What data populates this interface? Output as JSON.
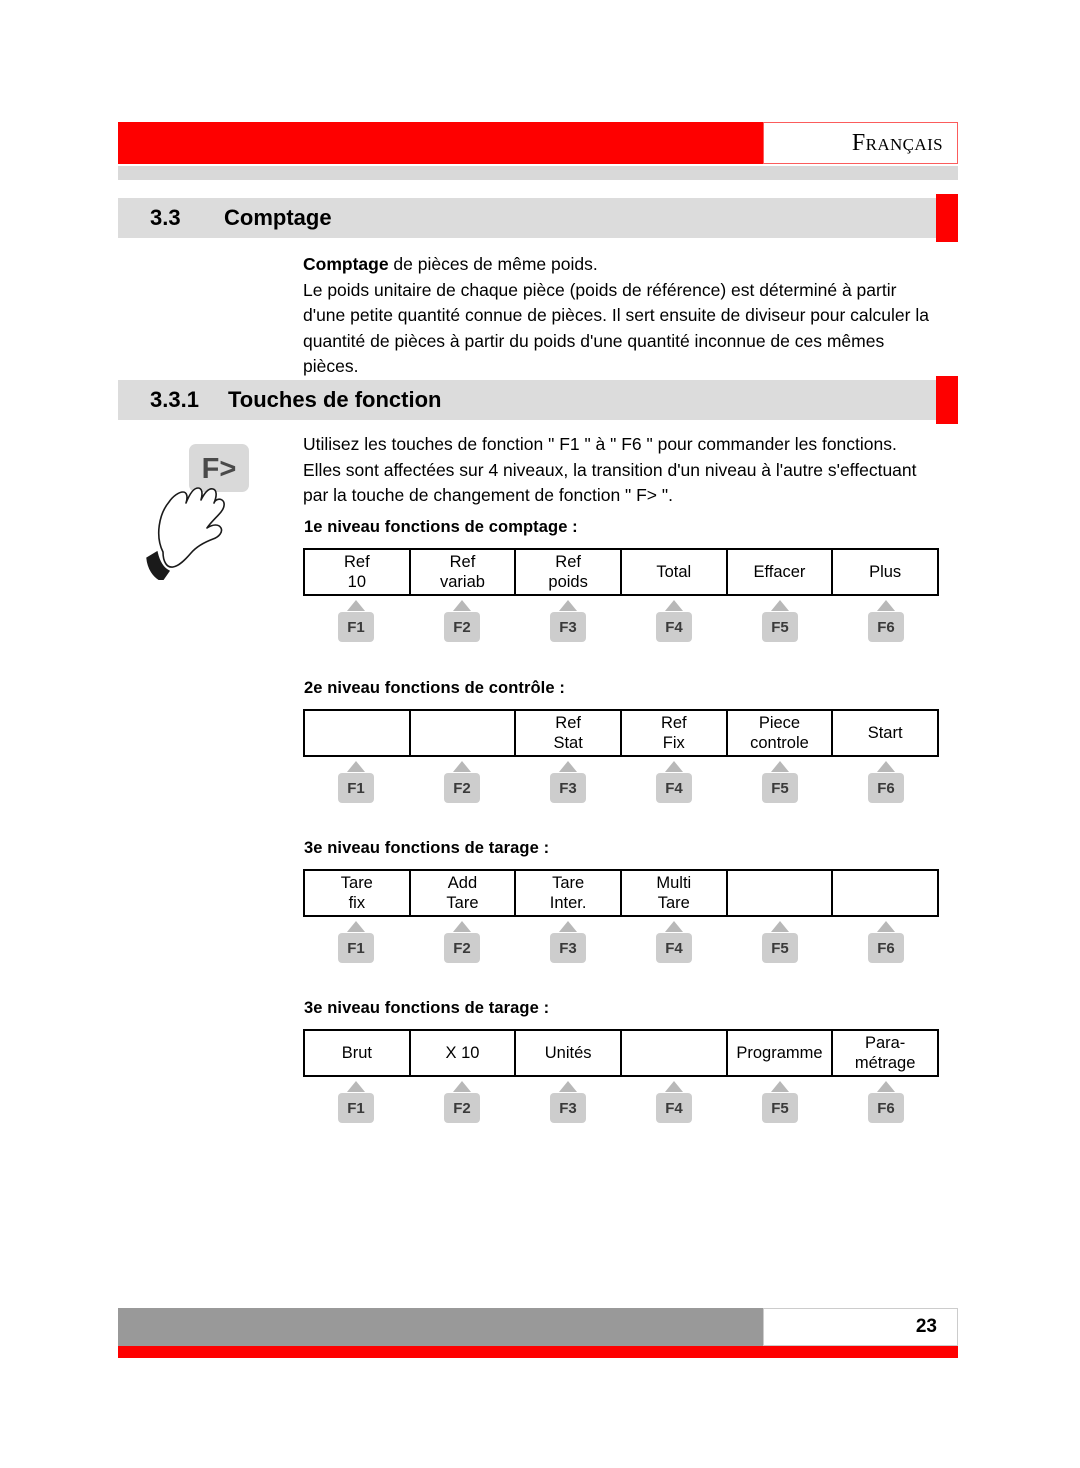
{
  "header": {
    "language_label": "Français",
    "accent_color": "#fe0000"
  },
  "sections": [
    {
      "number": "3.3",
      "title": "Comptage"
    },
    {
      "number": "3.3.1",
      "title": "Touches de fonction"
    }
  ],
  "intro": {
    "lead_bold": "Comptage",
    "lead_rest": " de pièces de même poids.",
    "paragraph": "Le poids unitaire de chaque pièce (poids de référence) est déterminé à partir d'une petite quantité connue de pièces. Il sert ensuite de diviseur pour calculer la quantité de pièces à partir du poids d'une quantité inconnue de ces mêmes pièces."
  },
  "fkeys_intro": {
    "line1": "Utilisez les touches de fonction \" F1 \" à \" F6 \" pour commander les fonctions.",
    "line2": "Elles sont affectées sur 4 niveaux, la transition d'un niveau à l'autre s'effectuant",
    "line3": "par la touche de changement de fonction \" F> \".",
    "key_cap": "F>"
  },
  "fkey_labels": [
    "F1",
    "F2",
    "F3",
    "F4",
    "F5",
    "F6"
  ],
  "levels": [
    {
      "label": "1e niveau fonctions de comptage :",
      "cells": [
        {
          "line1": "Ref",
          "line2": "10"
        },
        {
          "line1": "Ref",
          "line2": "variab"
        },
        {
          "line1": "Ref",
          "line2": "poids"
        },
        {
          "line1": "Total",
          "line2": ""
        },
        {
          "line1": "Effacer",
          "line2": ""
        },
        {
          "line1": "Plus",
          "line2": ""
        }
      ]
    },
    {
      "label": "2e niveau fonctions de contrôle :",
      "cells": [
        {
          "line1": "",
          "line2": ""
        },
        {
          "line1": "",
          "line2": ""
        },
        {
          "line1": "Ref",
          "line2": "Stat"
        },
        {
          "line1": "Ref",
          "line2": "Fix"
        },
        {
          "line1": "Piece",
          "line2": "controle"
        },
        {
          "line1": "Start",
          "line2": ""
        }
      ]
    },
    {
      "label": "3e niveau fonctions de tarage :",
      "cells": [
        {
          "line1": "Tare",
          "line2": "fix"
        },
        {
          "line1": "Add",
          "line2": "Tare"
        },
        {
          "line1": "Tare",
          "line2": "Inter."
        },
        {
          "line1": "Multi",
          "line2": "Tare"
        },
        {
          "line1": "",
          "line2": ""
        },
        {
          "line1": "",
          "line2": ""
        }
      ]
    },
    {
      "label": "3e niveau fonctions de tarage :",
      "cells": [
        {
          "line1": "Brut",
          "line2": ""
        },
        {
          "line1": "X 10",
          "line2": ""
        },
        {
          "line1": "Unités",
          "line2": ""
        },
        {
          "line1": "",
          "line2": ""
        },
        {
          "line1": "Programme",
          "line2": ""
        },
        {
          "line1": "Para-",
          "line2": "métrage"
        }
      ]
    }
  ],
  "footer": {
    "page_number": "23"
  }
}
